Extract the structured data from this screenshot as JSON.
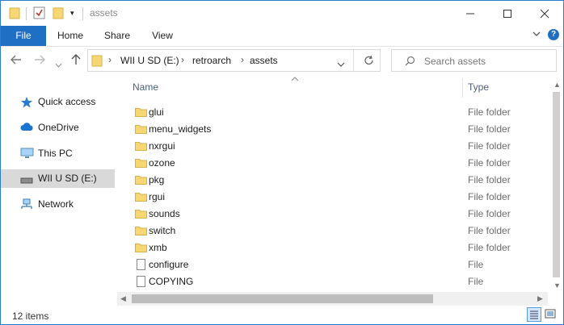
{
  "window": {
    "title": "assets",
    "controls": {
      "minimize": "minimize-icon",
      "maximize": "maximize-icon",
      "close": "close-icon"
    }
  },
  "ribbon": {
    "tabs": [
      "File",
      "Home",
      "Share",
      "View"
    ],
    "expand_icon": "chevron-down-icon",
    "help_label": "?"
  },
  "address": {
    "crumbs": [
      "WII U SD (E:)",
      "retroarch",
      "assets"
    ]
  },
  "search": {
    "placeholder": "Search assets"
  },
  "nav": {
    "items": [
      {
        "label": "Quick access",
        "icon": "star-icon"
      },
      {
        "label": "OneDrive",
        "icon": "cloud-icon"
      },
      {
        "label": "This PC",
        "icon": "computer-icon"
      },
      {
        "label": "WII U SD (E:)",
        "icon": "drive-icon",
        "selected": true
      },
      {
        "label": "Network",
        "icon": "network-icon"
      }
    ]
  },
  "columns": {
    "name": "Name",
    "type": "Type"
  },
  "files": [
    {
      "name": "glui",
      "type": "File folder",
      "kind": "folder"
    },
    {
      "name": "menu_widgets",
      "type": "File folder",
      "kind": "folder"
    },
    {
      "name": "nxrgui",
      "type": "File folder",
      "kind": "folder"
    },
    {
      "name": "ozone",
      "type": "File folder",
      "kind": "folder"
    },
    {
      "name": "pkg",
      "type": "File folder",
      "kind": "folder"
    },
    {
      "name": "rgui",
      "type": "File folder",
      "kind": "folder"
    },
    {
      "name": "sounds",
      "type": "File folder",
      "kind": "folder"
    },
    {
      "name": "switch",
      "type": "File folder",
      "kind": "folder"
    },
    {
      "name": "xmb",
      "type": "File folder",
      "kind": "folder"
    },
    {
      "name": "configure",
      "type": "File",
      "kind": "file"
    },
    {
      "name": "COPYING",
      "type": "File",
      "kind": "file"
    }
  ],
  "status": {
    "count": "12 items"
  },
  "colors": {
    "accent": "#1f6fc5",
    "folder": "#f7d774",
    "selected_nav": "#d9d9d9"
  }
}
